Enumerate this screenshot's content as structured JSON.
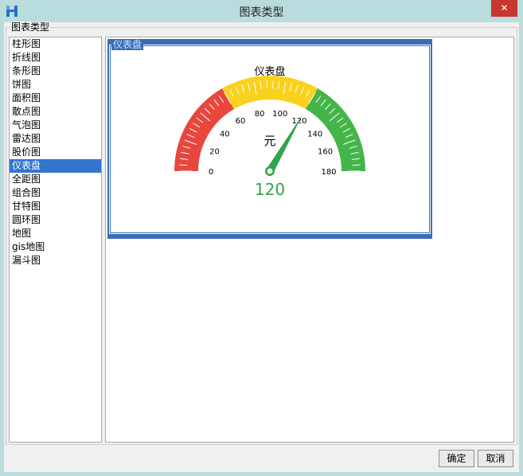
{
  "window": {
    "title": "图表类型"
  },
  "group": {
    "label": "图表类型"
  },
  "chart_types": [
    "柱形图",
    "折线图",
    "条形图",
    "饼图",
    "面积图",
    "散点图",
    "气泡图",
    "雷达图",
    "股价图",
    "仪表盘",
    "全距图",
    "组合图",
    "甘特图",
    "圆环图",
    "地图",
    "gis地图",
    "漏斗图"
  ],
  "selected_index": 9,
  "preview": {
    "frame_label": "仪表盘",
    "title": "仪表盘",
    "unit": "元",
    "value_text": "120"
  },
  "chart_data": {
    "type": "gauge",
    "min": 0,
    "max": 180,
    "value": 120,
    "ticks": [
      "0",
      "20",
      "40",
      "60",
      "80",
      "100",
      "120",
      "140",
      "160",
      "180"
    ],
    "bands": [
      {
        "from": 0,
        "to": 60,
        "color": "#e8473e"
      },
      {
        "from": 60,
        "to": 120,
        "color": "#fad11f"
      },
      {
        "from": 120,
        "to": 180,
        "color": "#45b449"
      }
    ],
    "needle_color": "#31a44a",
    "value_color": "#31a44a"
  },
  "buttons": {
    "ok": "确定",
    "cancel": "取消"
  },
  "colors": {
    "accent": "#3375cf",
    "frame": "#3a6db5",
    "close": "#c7362f"
  }
}
